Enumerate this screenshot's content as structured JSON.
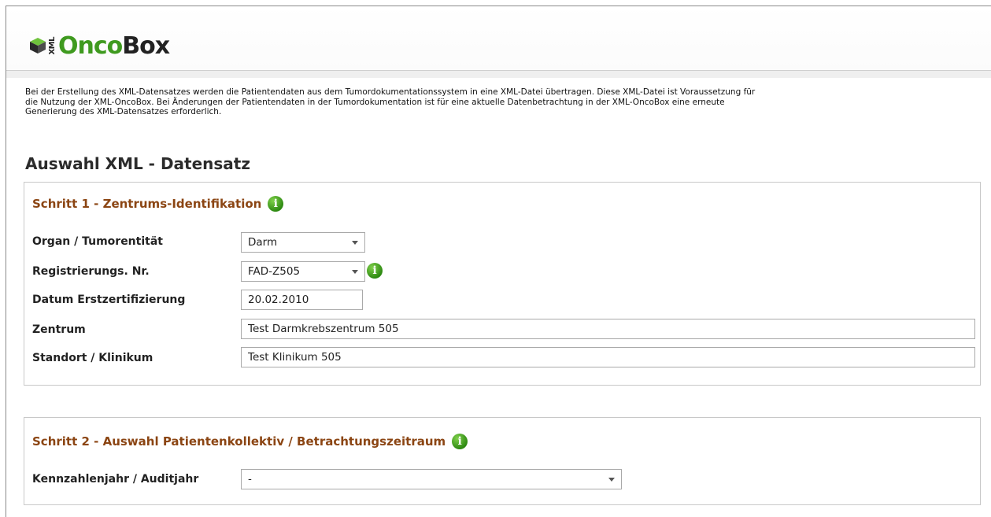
{
  "logo": {
    "xml": "XML",
    "onco": "Onco",
    "box": "Box"
  },
  "intro": {
    "line1": "Bei der Erstellung des XML-Datensatzes werden die Patientendaten aus dem Tumordokumentationssystem in eine XML-Datei übertragen. Diese XML-Datei ist Voraussetzung für",
    "line2": "die Nutzung der XML-OncoBox.  Bei Änderungen der Patientendaten in der Tumordokumentation ist für eine aktuelle Datenbetrachtung in der XML-OncoBox eine erneute",
    "line3": "Generierung des XML-Datensatzes erforderlich."
  },
  "page_title": "Auswahl XML - Datensatz",
  "step1": {
    "title": "Schritt 1 - Zentrums-Identifikation",
    "info_glyph": "i",
    "rows": {
      "organ": {
        "label": "Organ / Tumorentität",
        "value": "Darm"
      },
      "registrierung": {
        "label": "Registrierungs. Nr.",
        "value": "FAD-Z505"
      },
      "datum": {
        "label": "Datum Erstzertifizierung",
        "value": "20.02.2010"
      },
      "zentrum": {
        "label": "Zentrum",
        "value": "Test Darmkrebszentrum 505"
      },
      "standort": {
        "label": "Standort / Klinikum",
        "value": "Test Klinikum 505"
      }
    }
  },
  "step2": {
    "title": "Schritt 2 - Auswahl Patientenkollektiv  /  Betrachtungszeitraum",
    "info_glyph": "i",
    "rows": {
      "kennzahlenjahr": {
        "label": "Kennzahlenjahr / Auditjahr",
        "value": "-"
      }
    }
  },
  "colors": {
    "brand_green": "#3f9a1f",
    "step_title": "#8b4513",
    "info_icon": "#2e8a12"
  }
}
